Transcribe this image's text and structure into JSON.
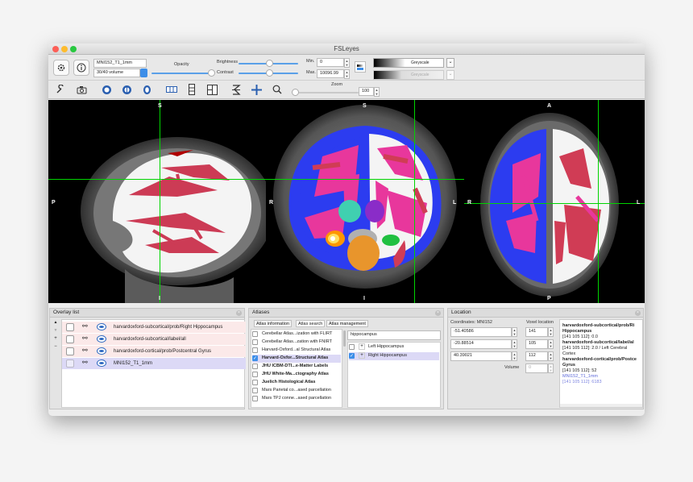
{
  "window": {
    "title": "FSLeyes"
  },
  "toolbar1": {
    "overlay_name": "MNI152_T1_1mm",
    "volume": "30/40 volume",
    "opacity_label": "Opacity",
    "brightness_label": "Brightness",
    "contrast_label": "Contrast",
    "min_label": "Min.",
    "min_value": "0",
    "max_label": "Max.",
    "max_value": "10096.99",
    "colormap1": "Greyscale",
    "colormap2": "Greyscale"
  },
  "toolbar2": {
    "zoom_label": "Zoom",
    "zoom_value": "100"
  },
  "views": {
    "sagittal": {
      "top": "S",
      "left": "P",
      "bottom": "I"
    },
    "coronal": {
      "top": "S",
      "left": "R",
      "right": "L",
      "bottom": "I"
    },
    "axial": {
      "top": "A",
      "left": "R",
      "right": "L",
      "bottom": "P"
    }
  },
  "overlay_list": {
    "title": "Overlay list",
    "items": [
      {
        "name": "harvardoxford-subcortical/prob/Right Hippocampus"
      },
      {
        "name": "harvardoxford-subcortical/label/all"
      },
      {
        "name": "harvardoxford-cortical/prob/Postcentral Gyrus"
      },
      {
        "name": "MNI152_T1_1mm"
      }
    ]
  },
  "atlases": {
    "title": "Atlases",
    "tabs": [
      "Atlas information",
      "Atlas search",
      "Atlas management"
    ],
    "items": [
      {
        "label": "Cerebellar Atlas...ization with FLIRT",
        "checked": false,
        "bold": false
      },
      {
        "label": "Cerebellar Atlas...zation with FNIRT",
        "checked": false,
        "bold": false
      },
      {
        "label": "Harvard-Oxford...al Structural Atlas",
        "checked": false,
        "bold": false
      },
      {
        "label": "Harvard-Oxfor...Structural Atlas",
        "checked": true,
        "bold": true
      },
      {
        "label": "JHU ICBM-DTI...e-Matter Labels",
        "checked": false,
        "bold": true
      },
      {
        "label": "JHU White-Ma...ctography Atlas",
        "checked": false,
        "bold": true
      },
      {
        "label": "Juelich Histological Atlas",
        "checked": false,
        "bold": true
      },
      {
        "label": "Mars Parietal co...ased parcellation",
        "checked": false,
        "bold": false
      },
      {
        "label": "Mars TPJ conne...ased parcellation",
        "checked": false,
        "bold": false
      }
    ],
    "search_value": "hippocampus",
    "results": [
      {
        "label": "Left Hippocampus",
        "checked": false
      },
      {
        "label": "Right Hippocampus",
        "checked": true
      }
    ]
  },
  "location": {
    "title": "Location",
    "coords_label": "Coordinates: MNI152",
    "voxel_label": "Voxel location",
    "coords": [
      "-51.40586",
      "-20.88514",
      "40.39021"
    ],
    "voxels": [
      "141",
      "105",
      "112"
    ],
    "volume_label": "Volume",
    "volume_value": "0",
    "info": [
      {
        "text": "harvardoxford-subcortical/prob/Ri",
        "style": "bold"
      },
      {
        "text": "Hippocampus",
        "style": "bold"
      },
      {
        "text": "[141 105 112]: 0.0",
        "style": "normal"
      },
      {
        "text": "harvardoxford-subcortical/label/al",
        "style": "bold"
      },
      {
        "text": "[141 105 112]: 2.0 / Left Cerebral",
        "style": "normal"
      },
      {
        "text": "Cortex",
        "style": "normal"
      },
      {
        "text": "harvardoxford-cortical/prob/Postce",
        "style": "bold"
      },
      {
        "text": "Gyrus",
        "style": "bold"
      },
      {
        "text": "[141 105 112]: 52",
        "style": "normal"
      },
      {
        "text": "MNI152_T1_1mm",
        "style": "blue"
      },
      {
        "text": "[141 105 112]: 6183",
        "style": "blue"
      }
    ]
  },
  "colors": {
    "accent": "#3d8ee8",
    "crosshair": "#00d400",
    "cortex_blue": "#2c3cf0",
    "magenta": "#e8379c",
    "red": "#d03c55"
  }
}
